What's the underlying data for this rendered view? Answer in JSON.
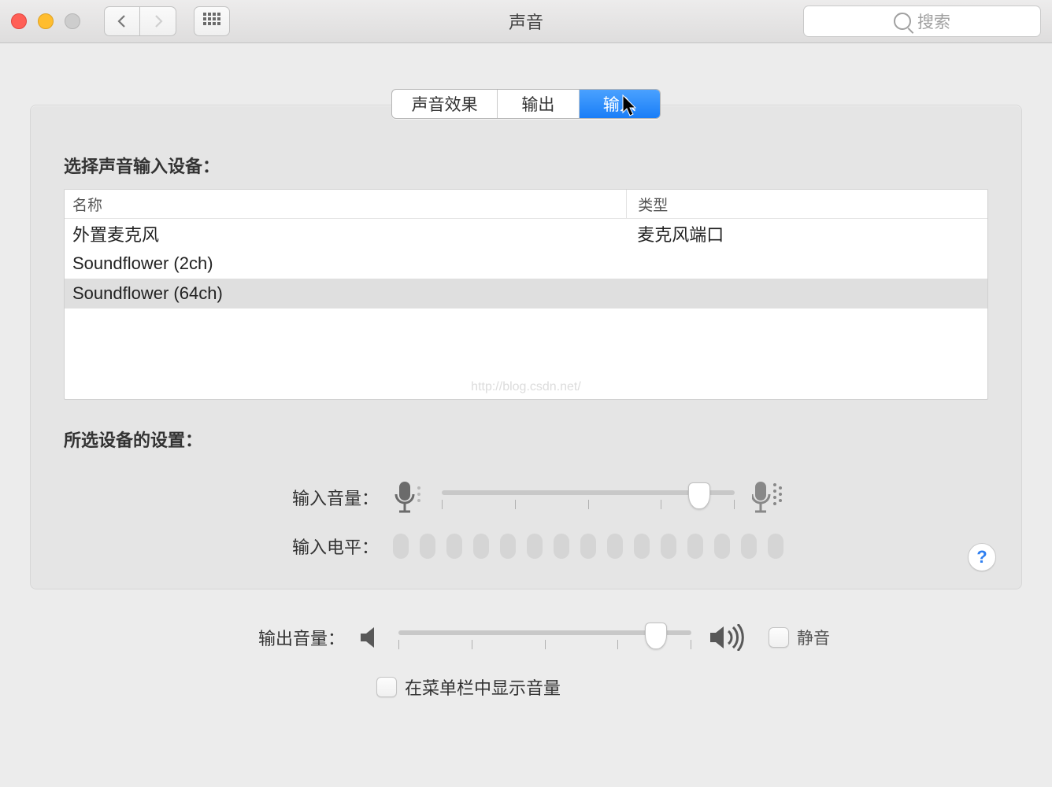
{
  "window": {
    "title": "声音"
  },
  "search": {
    "placeholder": "搜索"
  },
  "tabs": {
    "effects": "声音效果",
    "output": "输出",
    "input": "输入"
  },
  "input_section_label": "选择声音输入设备：",
  "table": {
    "headers": {
      "name": "名称",
      "type": "类型"
    },
    "rows": [
      {
        "name": "外置麦克风",
        "type": "麦克风端口"
      },
      {
        "name": "Soundflower (2ch)",
        "type": ""
      },
      {
        "name": "Soundflower (64ch)",
        "type": ""
      }
    ],
    "selected_index": 2
  },
  "watermark": "http://blog.csdn.net/",
  "settings_label": "所选设备的设置：",
  "input_volume_label": "输入音量：",
  "input_volume_percent": 88,
  "input_level_label": "输入电平：",
  "input_level_segments": 15,
  "help_label": "?",
  "output_volume_label": "输出音量：",
  "output_volume_percent": 88,
  "mute_label": "静音",
  "mute_checked": false,
  "menubar_label": "在菜单栏中显示音量",
  "menubar_checked": false
}
